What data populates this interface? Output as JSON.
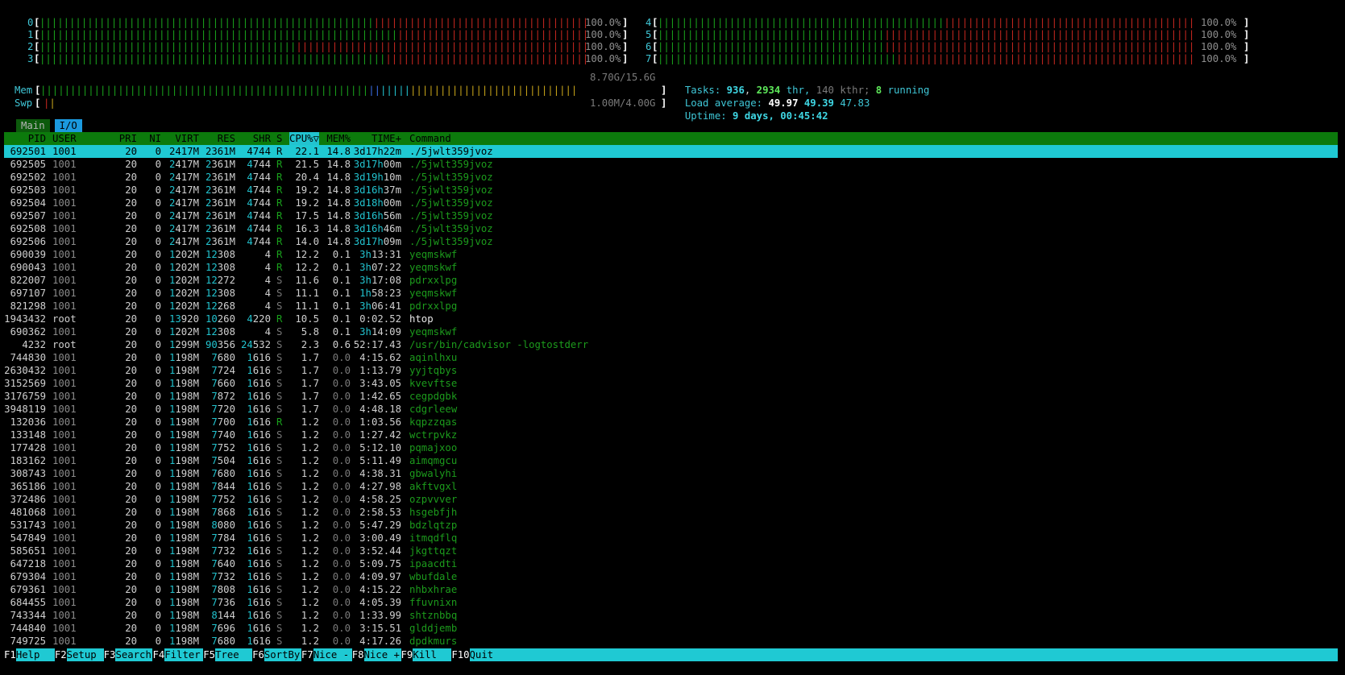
{
  "cpus": [
    {
      "label": "0",
      "pct": "100.0%"
    },
    {
      "label": "1",
      "pct": "100.0%"
    },
    {
      "label": "2",
      "pct": "100.0%"
    },
    {
      "label": "3",
      "pct": "100.0%"
    },
    {
      "label": "4",
      "pct": "100.0%"
    },
    {
      "label": "5",
      "pct": "100.0%"
    },
    {
      "label": "6",
      "pct": "100.0%"
    },
    {
      "label": "7",
      "pct": "100.0%"
    }
  ],
  "mem": {
    "label": "Mem",
    "value": "8.70G/15.6G"
  },
  "swp": {
    "label": "Swp",
    "value": "1.00M/4.00G"
  },
  "tasks": {
    "label": "Tasks:",
    "count": "936",
    "thr": "2934",
    "thr_label": "thr,",
    "kthr": "140",
    "kthr_label": "kthr;",
    "running": "8",
    "running_label": "running"
  },
  "load": {
    "label": "Load average:",
    "one": "49.97",
    "five": "49.39",
    "fifteen": "47.83"
  },
  "uptime": {
    "label": "Uptime:",
    "value": "9 days, 00:45:42"
  },
  "tabs": [
    "Main",
    "I/O"
  ],
  "columns": [
    "PID",
    "USER",
    "PRI",
    "NI",
    "VIRT",
    "RES",
    "SHR",
    "S",
    "CPU%▽",
    "MEM%",
    "TIME+",
    "Command"
  ],
  "processes": [
    [
      "692501",
      "1001",
      "20",
      "0",
      "2417M",
      "2361M",
      "4744",
      "R",
      "22.1",
      "14.8",
      "3d17h22m",
      "./5jwlt359jvoz"
    ],
    [
      "692505",
      "1001",
      "20",
      "0",
      "2417M",
      "2361M",
      "4744",
      "R",
      "21.5",
      "14.8",
      "3d17h00m",
      "./5jwlt359jvoz"
    ],
    [
      "692502",
      "1001",
      "20",
      "0",
      "2417M",
      "2361M",
      "4744",
      "R",
      "20.4",
      "14.8",
      "3d19h10m",
      "./5jwlt359jvoz"
    ],
    [
      "692503",
      "1001",
      "20",
      "0",
      "2417M",
      "2361M",
      "4744",
      "R",
      "19.2",
      "14.8",
      "3d16h37m",
      "./5jwlt359jvoz"
    ],
    [
      "692504",
      "1001",
      "20",
      "0",
      "2417M",
      "2361M",
      "4744",
      "R",
      "19.2",
      "14.8",
      "3d18h00m",
      "./5jwlt359jvoz"
    ],
    [
      "692507",
      "1001",
      "20",
      "0",
      "2417M",
      "2361M",
      "4744",
      "R",
      "17.5",
      "14.8",
      "3d16h56m",
      "./5jwlt359jvoz"
    ],
    [
      "692508",
      "1001",
      "20",
      "0",
      "2417M",
      "2361M",
      "4744",
      "R",
      "16.3",
      "14.8",
      "3d16h46m",
      "./5jwlt359jvoz"
    ],
    [
      "692506",
      "1001",
      "20",
      "0",
      "2417M",
      "2361M",
      "4744",
      "R",
      "14.0",
      "14.8",
      "3d17h09m",
      "./5jwlt359jvoz"
    ],
    [
      "690039",
      "1001",
      "20",
      "0",
      "1202M",
      "12308",
      "4",
      "R",
      "12.2",
      "0.1",
      "3h13:31",
      "yeqmskwf"
    ],
    [
      "690043",
      "1001",
      "20",
      "0",
      "1202M",
      "12308",
      "4",
      "R",
      "12.2",
      "0.1",
      "3h07:22",
      "yeqmskwf"
    ],
    [
      "822007",
      "1001",
      "20",
      "0",
      "1202M",
      "12272",
      "4",
      "S",
      "11.6",
      "0.1",
      "3h17:08",
      "pdrxxlpg"
    ],
    [
      "697107",
      "1001",
      "20",
      "0",
      "1202M",
      "12308",
      "4",
      "S",
      "11.1",
      "0.1",
      "1h58:23",
      "yeqmskwf"
    ],
    [
      "821298",
      "1001",
      "20",
      "0",
      "1202M",
      "12268",
      "4",
      "S",
      "11.1",
      "0.1",
      "3h06:41",
      "pdrxxlpg"
    ],
    [
      "1943432",
      "root",
      "20",
      "0",
      "13920",
      "10260",
      "4220",
      "R",
      "10.5",
      "0.1",
      "0:02.52",
      "htop"
    ],
    [
      "690362",
      "1001",
      "20",
      "0",
      "1202M",
      "12308",
      "4",
      "S",
      "5.8",
      "0.1",
      "3h14:09",
      "yeqmskwf"
    ],
    [
      "4232",
      "root",
      "20",
      "0",
      "1299M",
      "90356",
      "24532",
      "S",
      "2.3",
      "0.6",
      "52:17.43",
      "/usr/bin/cadvisor -logtostderr"
    ],
    [
      "744830",
      "1001",
      "20",
      "0",
      "1198M",
      "7680",
      "1616",
      "S",
      "1.7",
      "0.0",
      "4:15.62",
      "aqinlhxu"
    ],
    [
      "2630432",
      "1001",
      "20",
      "0",
      "1198M",
      "7724",
      "1616",
      "S",
      "1.7",
      "0.0",
      "1:13.79",
      "yyjtqbys"
    ],
    [
      "3152569",
      "1001",
      "20",
      "0",
      "1198M",
      "7660",
      "1616",
      "S",
      "1.7",
      "0.0",
      "3:43.05",
      "kvevftse"
    ],
    [
      "3176759",
      "1001",
      "20",
      "0",
      "1198M",
      "7872",
      "1616",
      "S",
      "1.7",
      "0.0",
      "1:42.65",
      "cegpdgbk"
    ],
    [
      "3948119",
      "1001",
      "20",
      "0",
      "1198M",
      "7720",
      "1616",
      "S",
      "1.7",
      "0.0",
      "4:48.18",
      "cdgrleew"
    ],
    [
      "132036",
      "1001",
      "20",
      "0",
      "1198M",
      "7700",
      "1616",
      "R",
      "1.2",
      "0.0",
      "1:03.56",
      "kqpzzqas"
    ],
    [
      "133148",
      "1001",
      "20",
      "0",
      "1198M",
      "7740",
      "1616",
      "S",
      "1.2",
      "0.0",
      "1:27.42",
      "wctrpvkz"
    ],
    [
      "177428",
      "1001",
      "20",
      "0",
      "1198M",
      "7752",
      "1616",
      "S",
      "1.2",
      "0.0",
      "5:12.10",
      "pqmajxoo"
    ],
    [
      "183162",
      "1001",
      "20",
      "0",
      "1198M",
      "7504",
      "1616",
      "S",
      "1.2",
      "0.0",
      "5:11.49",
      "aimqmgcu"
    ],
    [
      "308743",
      "1001",
      "20",
      "0",
      "1198M",
      "7680",
      "1616",
      "S",
      "1.2",
      "0.0",
      "4:38.31",
      "gbwalyhi"
    ],
    [
      "365186",
      "1001",
      "20",
      "0",
      "1198M",
      "7844",
      "1616",
      "S",
      "1.2",
      "0.0",
      "4:27.98",
      "akftvgxl"
    ],
    [
      "372486",
      "1001",
      "20",
      "0",
      "1198M",
      "7752",
      "1616",
      "S",
      "1.2",
      "0.0",
      "4:58.25",
      "ozpvvver"
    ],
    [
      "481068",
      "1001",
      "20",
      "0",
      "1198M",
      "7868",
      "1616",
      "S",
      "1.2",
      "0.0",
      "2:58.53",
      "hsgebfjh"
    ],
    [
      "531743",
      "1001",
      "20",
      "0",
      "1198M",
      "8080",
      "1616",
      "S",
      "1.2",
      "0.0",
      "5:47.29",
      "bdzlqtzp"
    ],
    [
      "547849",
      "1001",
      "20",
      "0",
      "1198M",
      "7784",
      "1616",
      "S",
      "1.2",
      "0.0",
      "3:00.49",
      "itmqdflq"
    ],
    [
      "585651",
      "1001",
      "20",
      "0",
      "1198M",
      "7732",
      "1616",
      "S",
      "1.2",
      "0.0",
      "3:52.44",
      "jkgttqzt"
    ],
    [
      "647218",
      "1001",
      "20",
      "0",
      "1198M",
      "7640",
      "1616",
      "S",
      "1.2",
      "0.0",
      "5:09.75",
      "ipaacdti"
    ],
    [
      "679304",
      "1001",
      "20",
      "0",
      "1198M",
      "7732",
      "1616",
      "S",
      "1.2",
      "0.0",
      "4:09.97",
      "wbufdale"
    ],
    [
      "679361",
      "1001",
      "20",
      "0",
      "1198M",
      "7808",
      "1616",
      "S",
      "1.2",
      "0.0",
      "4:15.22",
      "nhbxhrae"
    ],
    [
      "684455",
      "1001",
      "20",
      "0",
      "1198M",
      "7736",
      "1616",
      "S",
      "1.2",
      "0.0",
      "4:05.39",
      "ffuvnixn"
    ],
    [
      "743344",
      "1001",
      "20",
      "0",
      "1198M",
      "8144",
      "1616",
      "S",
      "1.2",
      "0.0",
      "1:33.99",
      "shtznbbq"
    ],
    [
      "744840",
      "1001",
      "20",
      "0",
      "1198M",
      "7696",
      "1616",
      "S",
      "1.2",
      "0.0",
      "3:15.51",
      "glddjemb"
    ],
    [
      "749725",
      "1001",
      "20",
      "0",
      "1198M",
      "7680",
      "1616",
      "S",
      "1.2",
      "0.0",
      "4:17.26",
      "dpdkmurs"
    ]
  ],
  "footer": [
    {
      "key": "F1",
      "label": "Help"
    },
    {
      "key": "F2",
      "label": "Setup"
    },
    {
      "key": "F3",
      "label": "Search"
    },
    {
      "key": "F4",
      "label": "Filter"
    },
    {
      "key": "F5",
      "label": "Tree"
    },
    {
      "key": "F6",
      "label": "SortBy"
    },
    {
      "key": "F7",
      "label": "Nice -"
    },
    {
      "key": "F8",
      "label": "Nice +"
    },
    {
      "key": "F9",
      "label": "Kill"
    },
    {
      "key": "F10",
      "label": "Quit"
    }
  ],
  "colors": {
    "bg": "#000000",
    "selected_row": "#1fc9d3",
    "header_bg": "#0c7a0c",
    "bar_green": "#19a11c",
    "bar_red": "#c4271f"
  }
}
